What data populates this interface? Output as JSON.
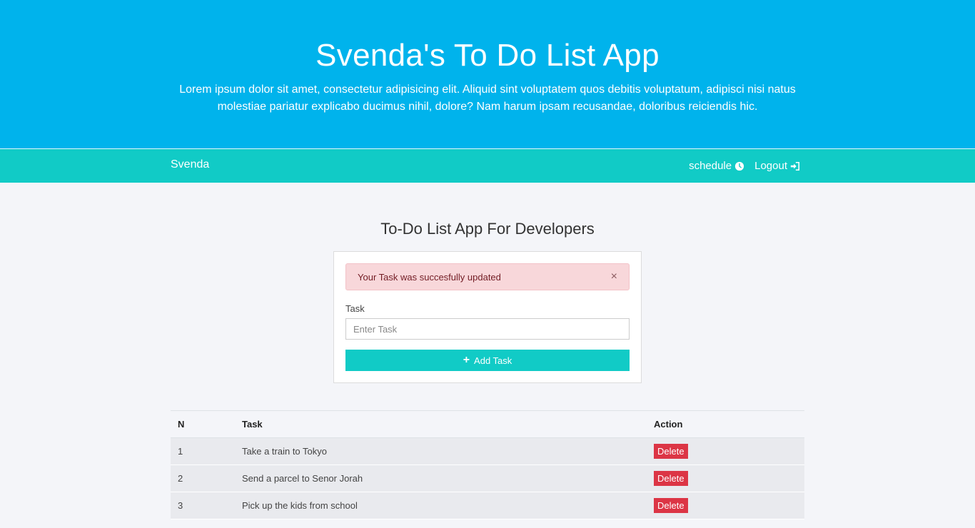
{
  "hero": {
    "title": "Svenda's To Do List App",
    "description": "Lorem ipsum dolor sit amet, consectetur adipisicing elit. Aliquid sint voluptatem quos debitis voluptatum, adipisci nisi natus molestiae pariatur explicabo ducimus nihil, dolore? Nam harum ipsam recusandae, doloribus reiciendis hic."
  },
  "navbar": {
    "brand": "Svenda",
    "schedule_label": "schedule",
    "logout_label": "Logout",
    "schedule_icon": "clock-icon",
    "logout_icon": "sign-in-icon"
  },
  "main": {
    "subtitle": "To-Do List App For Developers",
    "alert": {
      "message": "Your Task was succesfully updated",
      "close": "×"
    },
    "form": {
      "label": "Task",
      "placeholder": "Enter Task",
      "value": "",
      "button_label": "Add Task",
      "button_icon": "plus-icon"
    }
  },
  "table": {
    "headers": [
      "N",
      "Task",
      "Action"
    ],
    "rows": [
      {
        "n": "1",
        "task": "Take a train to Tokyo",
        "action": "Delete"
      },
      {
        "n": "2",
        "task": "Send a parcel to Senor Jorah",
        "action": "Delete"
      },
      {
        "n": "3",
        "task": "Pick up the kids from school",
        "action": "Delete"
      }
    ]
  },
  "colors": {
    "hero_bg": "#00b3ec",
    "navbar_bg": "#11cbc6",
    "danger": "#dc3545",
    "alert_bg": "#f8d7da"
  }
}
